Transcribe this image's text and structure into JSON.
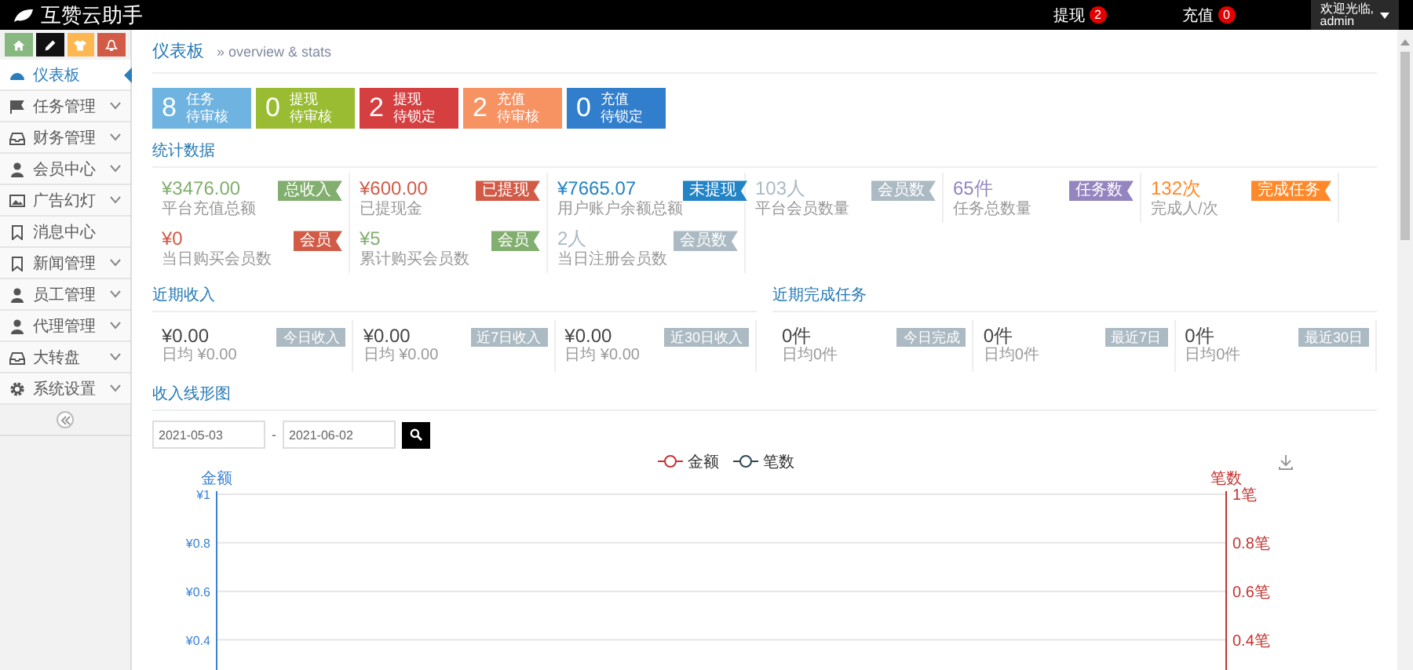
{
  "header": {
    "logo": "互赞云助手",
    "counters": [
      {
        "label": "提现",
        "count": "2"
      },
      {
        "label": "充值",
        "count": "0"
      }
    ],
    "user": {
      "greeting": "欢迎光临,",
      "name": "admin"
    }
  },
  "shortcuts": [
    {
      "kind": "home",
      "color": "#87b87f"
    },
    {
      "kind": "pencil",
      "color": "#111111"
    },
    {
      "kind": "shirt",
      "color": "#ffb752"
    },
    {
      "kind": "bell",
      "color": "#d15b47"
    }
  ],
  "sidebar": {
    "items": [
      {
        "label": "仪表板",
        "kind": "dashboard",
        "selected": true,
        "submenu": false
      },
      {
        "label": "任务管理",
        "kind": "flag",
        "selected": false,
        "submenu": true
      },
      {
        "label": "财务管理",
        "kind": "tray",
        "selected": false,
        "submenu": true
      },
      {
        "label": "会员中心",
        "kind": "user",
        "selected": false,
        "submenu": true
      },
      {
        "label": "广告幻灯",
        "kind": "image",
        "selected": false,
        "submenu": true
      },
      {
        "label": "消息中心",
        "kind": "bookmark",
        "selected": false,
        "submenu": false
      },
      {
        "label": "新闻管理",
        "kind": "bookmark",
        "selected": false,
        "submenu": true
      },
      {
        "label": "员工管理",
        "kind": "user",
        "selected": false,
        "submenu": true
      },
      {
        "label": "代理管理",
        "kind": "user",
        "selected": false,
        "submenu": true
      },
      {
        "label": "大转盘",
        "kind": "tray",
        "selected": false,
        "submenu": true
      },
      {
        "label": "系统设置",
        "kind": "gear",
        "selected": false,
        "submenu": true
      }
    ]
  },
  "breadcrumb": {
    "title": "仪表板",
    "subtitle": "» overview & stats"
  },
  "tiles": [
    {
      "count": "8",
      "line1": "任务",
      "line2": "待审核",
      "color": "#6fb3e0"
    },
    {
      "count": "0",
      "line1": "提现",
      "line2": "待审核",
      "color": "#9abc32"
    },
    {
      "count": "2",
      "line1": "提现",
      "line2": "待锁定",
      "color": "#d53f40"
    },
    {
      "count": "2",
      "line1": "充值",
      "line2": "待审核",
      "color": "#f79263"
    },
    {
      "count": "0",
      "line1": "充值",
      "line2": "待锁定",
      "color": "#307ecc"
    }
  ],
  "stats": {
    "title": "统计数据",
    "cells": [
      {
        "value": "¥3476.00",
        "badge": "总收入",
        "caption": "平台充值总额",
        "color": "#82af6f"
      },
      {
        "value": "¥600.00",
        "badge": "已提现",
        "caption": "已提现金",
        "color": "#d15b47"
      },
      {
        "value": "¥7665.07",
        "badge": "未提现",
        "caption": "用户账户余额总额",
        "color": "#2283c5"
      },
      {
        "value": "103人",
        "badge": "会员数",
        "caption": "平台会员数量",
        "color": "#abbac3"
      },
      {
        "value": "65件",
        "badge": "任务数",
        "caption": "任务总数量",
        "color": "#9585bf"
      },
      {
        "value": "132次",
        "badge": "完成任务",
        "caption": "完成人/次",
        "color": "#ff892a"
      },
      {
        "value": "¥0",
        "badge": "会员",
        "caption": "当日购买会员数",
        "color": "#d15b47"
      },
      {
        "value": "¥5",
        "badge": "会员",
        "caption": "累计购买会员数",
        "color": "#82af6f"
      },
      {
        "value": "2人",
        "badge": "会员数",
        "caption": "当日注册会员数",
        "color": "#abbac3"
      }
    ]
  },
  "recent": [
    {
      "title": "近期收入",
      "cells": [
        {
          "value": "¥0.00",
          "badge": "今日收入",
          "caption": "日均 ¥0.00"
        },
        {
          "value": "¥0.00",
          "badge": "近7日收入",
          "caption": "日均 ¥0.00"
        },
        {
          "value": "¥0.00",
          "badge": "近30日收入",
          "caption": "日均 ¥0.00"
        }
      ]
    },
    {
      "title": "近期完成任务",
      "cells": [
        {
          "value": "0件",
          "badge": "今日完成",
          "caption": "日均0件"
        },
        {
          "value": "0件",
          "badge": "最近7日",
          "caption": "日均0件"
        },
        {
          "value": "0件",
          "badge": "最近30日",
          "caption": "日均0件"
        }
      ]
    }
  ],
  "income_chart": {
    "title": "收入线形图",
    "date_from": "2021-05-03",
    "separator": "-",
    "date_to": "2021-06-02",
    "chart_data": {
      "type": "line",
      "ylabel": "金额",
      "y2label": "笔数",
      "ylim": [
        0.25,
        1
      ],
      "grid": true,
      "y2lim": [
        0.25,
        1
      ],
      "series": [
        {
          "name": "金额",
          "color": "#c23531"
        },
        {
          "name": "笔数",
          "color": "#2f4554"
        }
      ],
      "yticks": [
        {
          "value": 1,
          "label": "¥1"
        },
        {
          "value": 0.8,
          "label": "¥0.8"
        },
        {
          "value": 0.6,
          "label": "¥0.6"
        },
        {
          "value": 0.4,
          "label": "¥0.4"
        }
      ],
      "y2ticks": [
        {
          "value": 1,
          "label": "1笔"
        },
        {
          "value": 0.8,
          "label": "0.8笔"
        },
        {
          "value": 0.6,
          "label": "0.6笔"
        },
        {
          "value": 0.4,
          "label": "0.4笔"
        }
      ]
    }
  }
}
